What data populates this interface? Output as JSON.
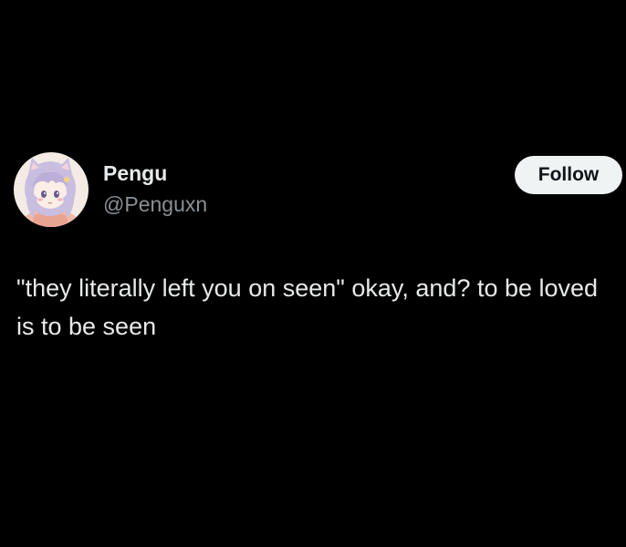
{
  "author": {
    "display_name": "Pengu",
    "handle": "@Penguxn",
    "avatar_icon": "anime-girl-avatar-icon"
  },
  "actions": {
    "follow_label": "Follow"
  },
  "post": {
    "text": "\"they literally left you on seen\" okay, and? to be loved is to be seen"
  },
  "colors": {
    "background": "#000000",
    "primary_text": "#e7e9ea",
    "secondary_text": "#8b9095",
    "button_bg": "#eff3f4",
    "button_text": "#0f1419"
  }
}
